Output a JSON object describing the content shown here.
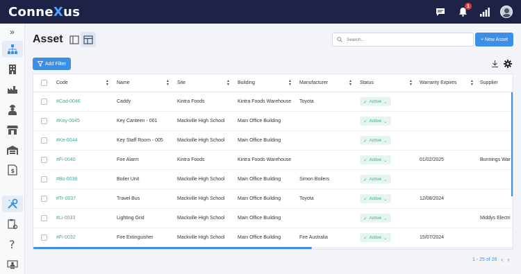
{
  "app": {
    "logo_pre": "Conne",
    "logo_x": "X",
    "logo_post": "us",
    "notification_count": "1"
  },
  "page": {
    "title": "Asset"
  },
  "search": {
    "placeholder": "Search..."
  },
  "actions": {
    "new_asset": "+ New Asset",
    "add_filter": "Add Filter"
  },
  "table": {
    "columns": [
      "Code",
      "Name",
      "Site",
      "Building",
      "Manufacturer",
      "Status",
      "Warranty Expires",
      "Supplier"
    ],
    "rows": [
      {
        "code": "#Cad-0046",
        "name": "Caddy",
        "site": "Kintra Foods",
        "building": "Kintra Foods Warehouse",
        "manufacturer": "Toyota",
        "status": "Active",
        "warranty": "",
        "supplier": ""
      },
      {
        "code": "#Key-0045",
        "name": "Key Canteen - 001",
        "site": "Mackville High School",
        "building": "Main Office Building",
        "manufacturer": "",
        "status": "Active",
        "warranty": "",
        "supplier": ""
      },
      {
        "code": "#Ke-0044",
        "name": "Key Staff Room - 005",
        "site": "Mackville High School",
        "building": "Main Office Building",
        "manufacturer": "",
        "status": "Active",
        "warranty": "",
        "supplier": ""
      },
      {
        "code": "#Fi-0040",
        "name": "Fire Alarm",
        "site": "Kintra Foods",
        "building": "Kintra Foods Warehouse",
        "manufacturer": "",
        "status": "Active",
        "warranty": "01/02/2025",
        "supplier": "Bunnings War"
      },
      {
        "code": "#Bo-0038",
        "name": "Boiler Unit",
        "site": "Mackville High School",
        "building": "Main Office Building",
        "manufacturer": "Simon Boilers",
        "status": "Active",
        "warranty": "",
        "supplier": ""
      },
      {
        "code": "#Tr-0037",
        "name": "Travel Bus",
        "site": "Mackville High School",
        "building": "Main Office Building",
        "manufacturer": "Toyota",
        "status": "Active",
        "warranty": "12/08/2024",
        "supplier": ""
      },
      {
        "code": "#Li-0033",
        "name": "Lighting Grid",
        "site": "Mackville High School",
        "building": "Main Office Building",
        "manufacturer": "",
        "status": "Active",
        "warranty": "",
        "supplier": "Middys Electri"
      },
      {
        "code": "#Fi-0032",
        "name": "Fire Extinguisher",
        "site": "Mackville High School",
        "building": "Main Office Building",
        "manufacturer": "Fire Australia",
        "status": "Active",
        "warranty": "15/07/2024",
        "supplier": ""
      }
    ]
  },
  "pagination": {
    "label": "1 - 25 of 26"
  },
  "colors": {
    "navbar": "#1d2247",
    "accent": "#3d8fe6",
    "code_link": "#3aaa9a",
    "status_green": "#39b27f"
  },
  "icons": {
    "top": [
      "chat-icon",
      "bell-icon",
      "signal-icon",
      "avatar"
    ],
    "sidebar": [
      "hierarchy-icon",
      "building-icon",
      "factory-icon",
      "worker-icon",
      "store-icon",
      "warehouse-icon",
      "invoice-icon",
      "tools-icon",
      "clipboard-settings-icon",
      "help-icon",
      "user-screen-icon"
    ]
  }
}
